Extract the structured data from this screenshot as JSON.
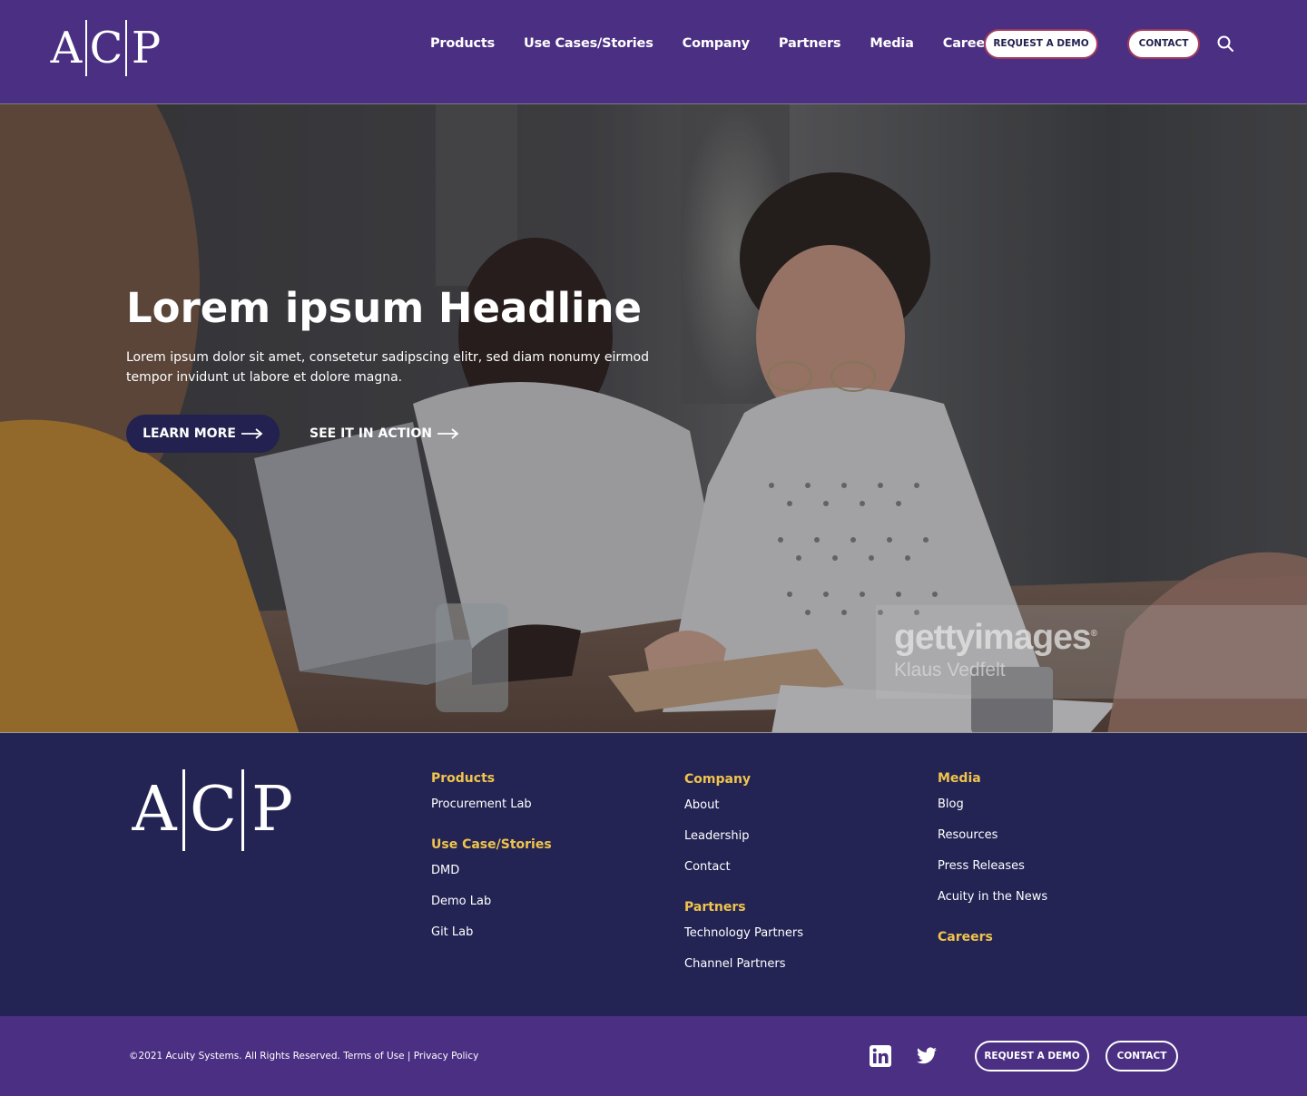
{
  "header": {
    "logo": {
      "letters": [
        "A",
        "C",
        "P"
      ]
    },
    "nav": [
      "Products",
      "Use Cases/Stories",
      "Company",
      "Partners",
      "Media",
      "Careers"
    ],
    "request_demo": "REQUEST A DEMO",
    "contact": "CONTACT",
    "search_icon": "search-icon"
  },
  "hero": {
    "title": "Lorem ipsum Headline",
    "subtitle": "Lorem ipsum dolor sit amet, consetetur sadipscing elitr, sed diam nonumy eirmod tempor invidunt ut labore et dolore magna.",
    "learn_more": "LEARN MORE",
    "see_it": "SEE IT IN ACTION",
    "watermark": {
      "brand": "gettyimages",
      "registered": "®",
      "credit": "Klaus Vedfelt"
    }
  },
  "footer": {
    "logo": {
      "letters": [
        "A",
        "C",
        "P"
      ]
    },
    "columns": [
      {
        "sections": [
          {
            "heading": "Products",
            "links": [
              "Procurement Lab"
            ]
          },
          {
            "heading": "Use Case/Stories",
            "links": [
              "DMD",
              "Demo Lab",
              "Git Lab"
            ]
          }
        ]
      },
      {
        "sections": [
          {
            "heading": "Company",
            "links": [
              "About",
              "Leadership",
              "Contact"
            ]
          },
          {
            "heading": "Partners",
            "links": [
              "Technology Partners",
              "Channel Partners"
            ]
          }
        ]
      },
      {
        "sections": [
          {
            "heading": "Media",
            "links": [
              "Blog",
              "Resources",
              "Press Releases",
              "Acuity in the News"
            ]
          },
          {
            "heading": "Careers",
            "links": []
          }
        ]
      }
    ]
  },
  "bottom": {
    "copyright": "©2021 Acuity Systems. All Rights Reserved. Terms of Use | Privacy Policy",
    "social": [
      "linkedin-icon",
      "twitter-icon"
    ],
    "request_demo": "REQUEST A DEMO",
    "contact": "CONTACT"
  },
  "colors": {
    "brand_purple": "#4b2f82",
    "footer_navy": "#232454",
    "accent_gold": "#f0c44c",
    "button_border": "#a23a5c"
  }
}
